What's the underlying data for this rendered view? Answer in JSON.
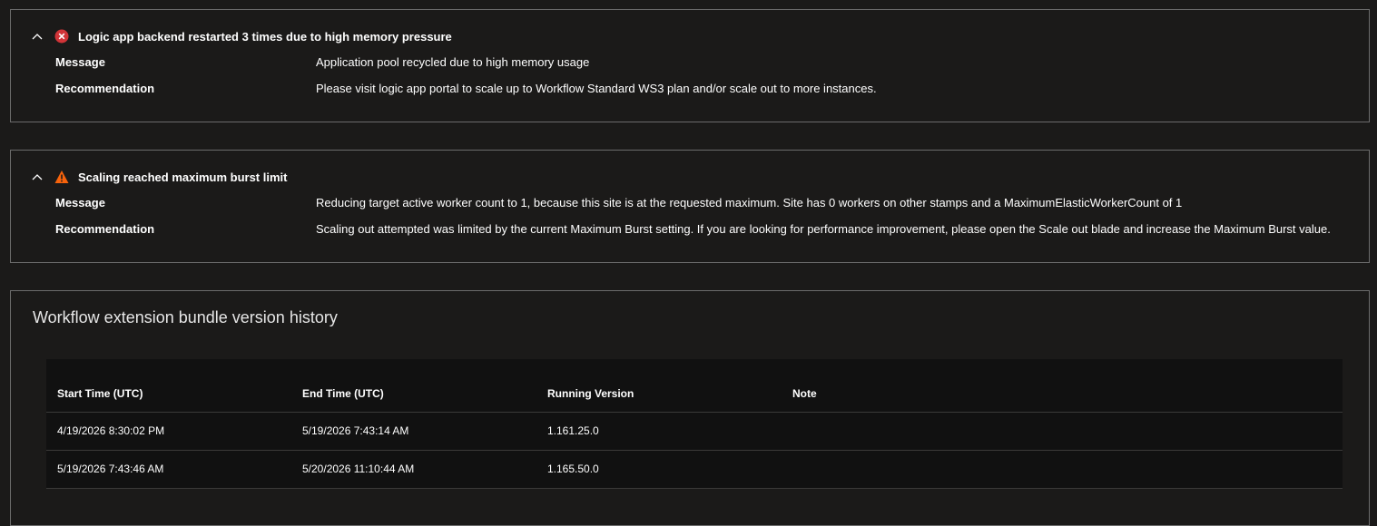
{
  "colors": {
    "background": "#1b1a19",
    "border": "#6b6b6b",
    "error": "#d13438",
    "warning": "#f7630c",
    "table_bg": "#111111"
  },
  "insights": [
    {
      "status_icon": "error-icon",
      "title": "Logic app backend restarted 3 times due to high memory pressure",
      "message_label": "Message",
      "message": "Application pool recycled due to high memory usage",
      "recommendation_label": "Recommendation",
      "recommendation": "Please visit logic app portal to scale up to Workflow Standard WS3 plan and/or scale out to more instances."
    },
    {
      "status_icon": "warning-icon",
      "title": "Scaling reached maximum burst limit",
      "message_label": "Message",
      "message": "Reducing target active worker count to 1, because this site is at the requested maximum. Site has 0 workers on other stamps and a MaximumElasticWorkerCount of 1",
      "recommendation_label": "Recommendation",
      "recommendation": "Scaling out attempted was limited by the current Maximum Burst setting. If you are looking for performance improvement, please open the Scale out blade and increase the Maximum Burst value."
    }
  ],
  "history": {
    "title": "Workflow extension bundle version history",
    "columns": [
      "Start Time (UTC)",
      "End Time (UTC)",
      "Running Version",
      "Note"
    ],
    "rows": [
      [
        "4/19/2026 8:30:02 PM",
        "5/19/2026 7:43:14 AM",
        "1.161.25.0",
        ""
      ],
      [
        "5/19/2026 7:43:46 AM",
        "5/20/2026 11:10:44 AM",
        "1.165.50.0",
        ""
      ]
    ]
  }
}
